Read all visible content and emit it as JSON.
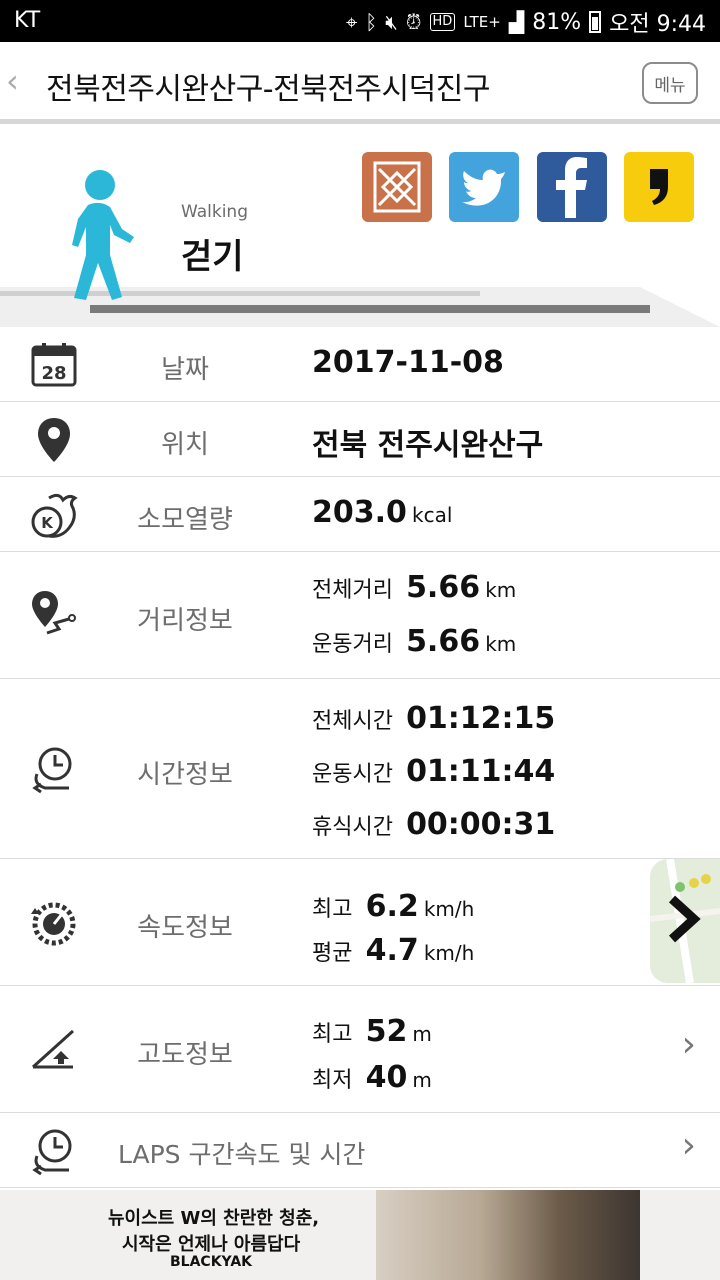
{
  "statusbar": {
    "carrier": "KT",
    "battery": "81%",
    "time": "오전 9:44",
    "network": "LTE+"
  },
  "header": {
    "title": "전북전주시완산구-전북전주시덕진구",
    "menu_label": "메뉴"
  },
  "hero": {
    "sub_label": "Walking",
    "main_label": "걷기",
    "accent": "#2bb8d8"
  },
  "rows": {
    "date": {
      "label": "날짜",
      "value": "2017-11-08",
      "icon_day": "28"
    },
    "location": {
      "label": "위치",
      "value": "전북 전주시완산구"
    },
    "calories": {
      "label": "소모열량",
      "value": "203.0",
      "unit": "kcal"
    },
    "distance": {
      "label": "거리정보",
      "total_label": "전체거리",
      "total_value": "5.66",
      "total_unit": "km",
      "active_label": "운동거리",
      "active_value": "5.66",
      "active_unit": "km"
    },
    "time": {
      "label": "시간정보",
      "total_label": "전체시간",
      "total_value": "01:12:15",
      "active_label": "운동시간",
      "active_value": "01:11:44",
      "rest_label": "휴식시간",
      "rest_value": "00:00:31"
    },
    "speed": {
      "label": "속도정보",
      "max_label": "최고",
      "max_value": "6.2",
      "max_unit": "km/h",
      "avg_label": "평균",
      "avg_value": "4.7",
      "avg_unit": "km/h"
    },
    "altitude": {
      "label": "고도정보",
      "max_label": "최고",
      "max_value": "52",
      "max_unit": "m",
      "min_label": "최저",
      "min_value": "40",
      "min_unit": "m"
    },
    "laps": {
      "label": "LAPS 구간속도 및 시간"
    }
  },
  "ad": {
    "line1": "뉴이스트 W의 찬란한 청춘,",
    "line2": "시작은 언제나 아름답다",
    "brand": "BLACKYAK"
  }
}
